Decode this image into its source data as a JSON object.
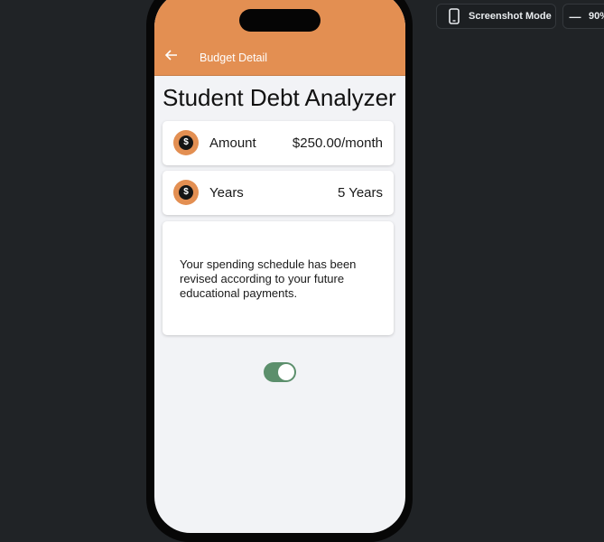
{
  "toolbar": {
    "screenshot_mode_label": "Screenshot Mode",
    "zoom_minus": "—",
    "zoom_level": "90%"
  },
  "app": {
    "appbar_title": "Budget Detail",
    "page_title": "Student Debt Analyzer",
    "rows": [
      {
        "label": "Amount",
        "value": "$250.00/month",
        "icon": "dollar-coin-icon"
      },
      {
        "label": "Years",
        "value": "5 Years",
        "icon": "dollar-coin-icon"
      }
    ],
    "message": "Your spending schedule has been revised according to your future educational payments.",
    "toggle_on": true
  },
  "colors": {
    "accent": "#e38f52",
    "toggle_on": "#5c8f6c",
    "background": "#202326"
  }
}
